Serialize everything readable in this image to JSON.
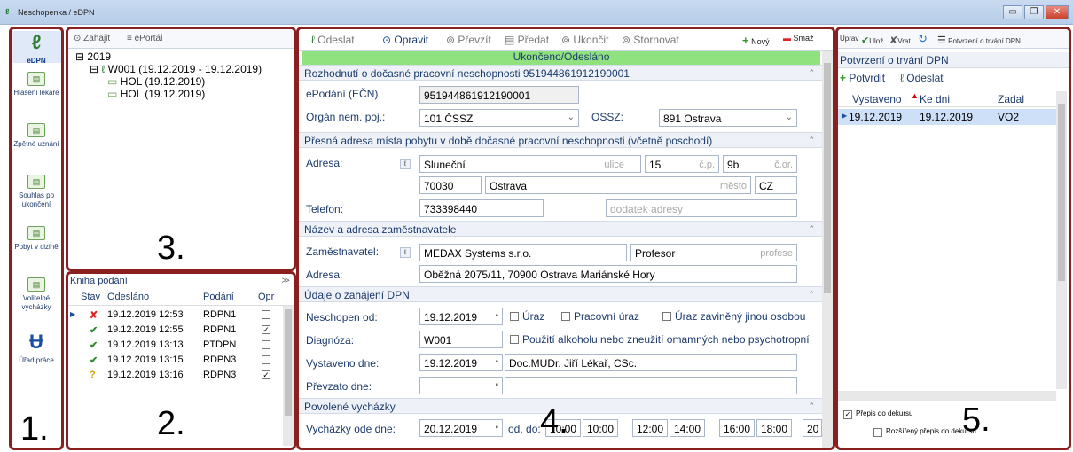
{
  "window": {
    "title": "Neschopenka / eDPN",
    "min": "▭",
    "max": "❐",
    "close": "✕"
  },
  "nav": [
    {
      "label": "eDPN",
      "icon": "edpn-logo-icon"
    },
    {
      "label": "Hlášení lékaře",
      "icon": "form-icon"
    },
    {
      "label": "Zpětné uznání",
      "icon": "form-icon"
    },
    {
      "label": "Souhlas po ukončení",
      "icon": "form-icon"
    },
    {
      "label": "Pobyt v cizině",
      "icon": "form-icon"
    },
    {
      "label": "Volitelné vycházky",
      "icon": "form-icon"
    },
    {
      "label": "Úřad práce",
      "icon": "up-logo-icon"
    }
  ],
  "tree_panel": {
    "toolbar": {
      "zahajit": "Zahajit",
      "eportal": "ePortál"
    },
    "tree": [
      "2019",
      "W001 (19.12.2019 - 19.12.2019)",
      "HOL (19.12.2019)",
      "HOL (19.12.2019)"
    ]
  },
  "log_panel": {
    "title": "Kniha podání",
    "columns": [
      "Stav",
      "Odesláno",
      "Podání",
      "Opr"
    ],
    "rows": [
      {
        "status": "✘",
        "sent": "19.12.2019 12:53",
        "type": "RDPN1",
        "opr": ""
      },
      {
        "status": "✔",
        "sent": "19.12.2019 12:55",
        "type": "RDPN1",
        "opr": "☑"
      },
      {
        "status": "✔",
        "sent": "19.12.2019 13:13",
        "type": "PTDPN",
        "opr": ""
      },
      {
        "status": "✔",
        "sent": "19.12.2019 13:15",
        "type": "RDPN3",
        "opr": ""
      },
      {
        "status": "?",
        "sent": "19.12.2019 13:16",
        "type": "RDPN3",
        "opr": "☑"
      }
    ]
  },
  "main": {
    "toolbar": {
      "odeslat": "Odeslat",
      "opravit": "Opravit",
      "prevzit": "Převzít",
      "predat": "Předat",
      "ukoncit": "Ukončit",
      "stornovat": "Stornovat",
      "novy": "Nový",
      "smaz": "Smaž"
    },
    "status_banner": "Ukončeno/Odesláno",
    "section1": {
      "title": "Rozhodnutí o dočasné pracovní neschopnosti 951944861912190001",
      "epodani_label": "ePodání (EČN)",
      "epodani_value": "951944861912190001",
      "organ_label": "Orgán nem. poj.:",
      "organ_value": "101  ČSSZ",
      "ossz_label": "OSSZ:",
      "ossz_value": "891  Ostrava"
    },
    "section2": {
      "title": "Přesná adresa místa pobytu v době dočasné pracovní neschopnosti (včetně poschodí)",
      "adresa_label": "Adresa:",
      "ulice_value": "Sluneční",
      "ulice_ph": "ulice",
      "cp_value": "15",
      "cp_ph": "č.p.",
      "cor_value": "9b",
      "cor_ph": "č.or.",
      "psc_value": "70030",
      "mesto_value": "Ostrava",
      "mesto_ph": "město",
      "stat_value": "CZ",
      "telefon_label": "Telefon:",
      "telefon_value": "733398440",
      "dodatek_ph": "dodatek adresy"
    },
    "section3": {
      "title": "Název a adresa zaměstnavatele",
      "zam_label": "Zaměstnavatel:",
      "zam_value": "MEDAX Systems s.r.o.",
      "profese_value": "Profesor",
      "profese_ph": "profese",
      "adresa_label": "Adresa:",
      "adresa_value": "Oběžná 2075/11, 70900 Ostrava Mariánské Hory"
    },
    "section4": {
      "title": "Údaje o zahájení DPN",
      "neschopen_label": "Neschopen od:",
      "neschopen_value": "19.12.2019",
      "uraz": "Úraz",
      "pracovni_uraz": "Pracovní úraz",
      "uraz_jinou": "Úraz zaviněný jinou osobou",
      "diagnoza_label": "Diagnóza:",
      "diagnoza_value": "W001",
      "alkohol": "Použití alkoholu nebo zneužití omamných nebo psychotropní",
      "vystaveno_label": "Vystaveno dne:",
      "vystaveno_value": "19.12.2019",
      "lekar_value": "Doc.MUDr. Jiří Lékař, CSc.",
      "prevzato_label": "Převzato dne:"
    },
    "section5": {
      "title": "Povolené vycházky",
      "vychazky_label": "Vycházky ode dne:",
      "vychazky_value": "20.12.2019",
      "od_do": "od, do:",
      "times": [
        "10:00",
        "10:00",
        "12:00",
        "14:00",
        "16:00",
        "18:00",
        "20"
      ]
    }
  },
  "right": {
    "toolbar": {
      "uprav": "Uprav",
      "uloz": "Ulož",
      "vrat": "Vrat",
      "potvrzeni": "Potvrzení o trvání DPN"
    },
    "title": "Potvrzení o trvání DPN",
    "potvrdit": "Potvrdit",
    "odeslat": "Odeslat",
    "columns": [
      "Vystaveno",
      "Ke dni",
      "Zadal"
    ],
    "rows": [
      {
        "vystaveno": "19.12.2019",
        "ke_dni": "19.12.2019",
        "zadal": "VO2"
      }
    ],
    "prepis": "Přepis do dekursu",
    "rozsireny": "Rozšířený přepis do dekursu"
  },
  "annotations": [
    "1.",
    "2.",
    "3.",
    "4.",
    "5."
  ]
}
